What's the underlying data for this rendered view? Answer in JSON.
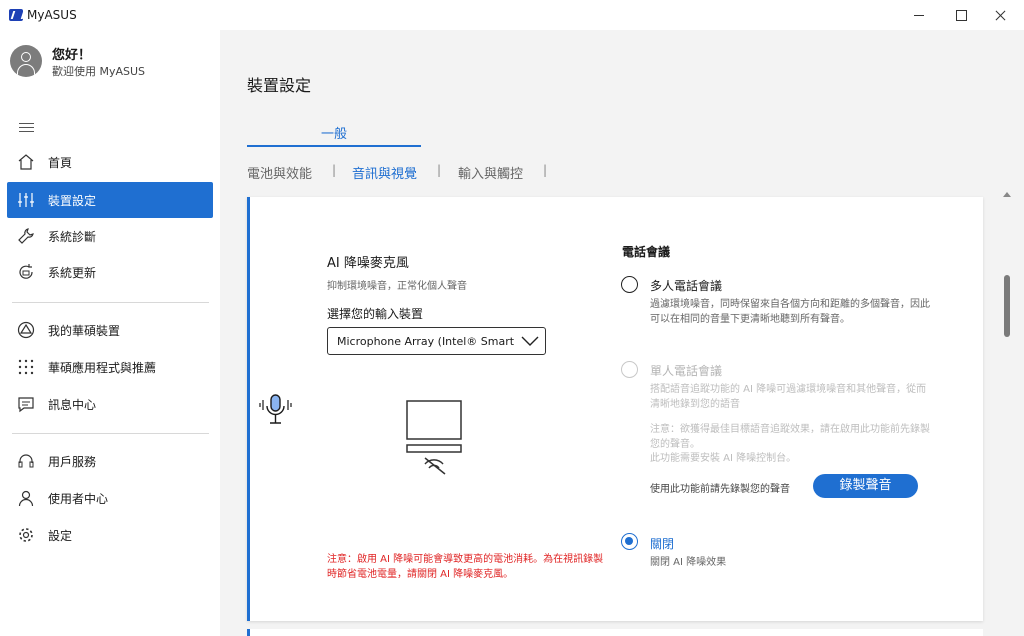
{
  "window": {
    "title": "MyASUS"
  },
  "user": {
    "greeting": "您好！",
    "welcome": "歡迎使用 MyASUS"
  },
  "sidebar": {
    "items": [
      {
        "label": "首頁",
        "icon": "home-icon"
      },
      {
        "label": "裝置設定",
        "icon": "sliders-icon",
        "active": true
      },
      {
        "label": "系統診斷",
        "icon": "wrench-icon"
      },
      {
        "label": "系統更新",
        "icon": "update-icon"
      },
      {
        "label": "我的華碩裝置",
        "icon": "triangle-circle-icon"
      },
      {
        "label": "華碩應用程式與推薦",
        "icon": "grid-dots-icon"
      },
      {
        "label": "訊息中心",
        "icon": "message-icon"
      },
      {
        "label": "用戶服務",
        "icon": "headset-icon"
      },
      {
        "label": "使用者中心",
        "icon": "user-icon"
      },
      {
        "label": "設定",
        "icon": "gear-icon"
      }
    ]
  },
  "main": {
    "title": "裝置設定",
    "group_tab": "一般",
    "subtabs": [
      "電池與效能",
      "音訊與視覺",
      "輸入與觸控"
    ],
    "active_subtab": "音訊與視覺",
    "separator": "|"
  },
  "feature": {
    "title": "AI 降噪麥克風",
    "desc": "抑制環境噪音，正常化個人聲音",
    "select_label": "選擇您的輸入裝置",
    "select_value": "Microphone Array (Intel® Smart Sound Technology)",
    "warning": "注意：啟用 AI 降噪可能會導致更高的電池消耗。為在視訊錄製時節省電池電量，請關閉 AI 降噪麥克風。"
  },
  "conference": {
    "title": "電話會議",
    "options": [
      {
        "label": "多人電話會議",
        "desc": "過濾環境噪音，同時保留來自各個方向和距離的多個聲音，因此可以在相同的音量下更清晰地聽到所有聲音。",
        "state": "unchecked"
      },
      {
        "label": "單人電話會議",
        "desc": "搭配語音追蹤功能的 AI 降噪可過濾環境噪音和其他聲音，從而清晰地錄到您的語音",
        "note": "注意：欲獲得最佳目標語音追蹤效果，請在啟用此功能前先錄製您的聲音。",
        "note2": "此功能需要安裝 AI 降噪控制台。",
        "state": "disabled"
      },
      {
        "label": "關閉",
        "desc": "關閉 AI 降噪效果",
        "state": "checked"
      }
    ],
    "record_note": "使用此功能前請先錄製您的聲音",
    "record_button": "錄製聲音"
  },
  "colors": {
    "accent": "#1f6fd1",
    "warning": "#e02424",
    "sidebar_bg": "#ffffff",
    "content_bg": "#f3f3f3"
  }
}
